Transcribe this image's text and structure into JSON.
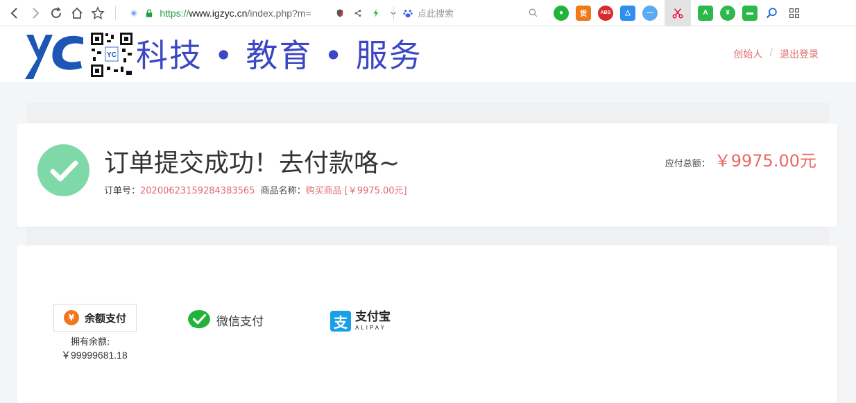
{
  "browser": {
    "url_scheme": "https://",
    "url_host": "www.igzyc.cn",
    "url_path": "/index.php?m=",
    "search_placeholder": "点此搜索"
  },
  "site": {
    "logo_text": "YC",
    "slogan": "科技 • 教育 • 服务",
    "user_link": "创始人",
    "separator": "/",
    "logout_link": "退出登录"
  },
  "order": {
    "title": "订单提交成功！去付款咯~",
    "order_no_label": "订单号：",
    "order_no": "20200623159284383565",
    "product_label": "商品名称：",
    "product_value": "购买商品 [￥9975.00元]",
    "total_label": "应付总额：",
    "total_amount": "￥9975.00元"
  },
  "payment": {
    "balance_label": "余额支付",
    "coin_symbol": "¥",
    "balance_caption": "拥有余额:",
    "balance_value": "￥99999681.18",
    "wechat_label": "微信支付",
    "alipay_icon": "支",
    "alipay_cn": "支付宝",
    "alipay_en": "ALIPAY"
  },
  "colors": {
    "accent_red": "#e06b6b",
    "success_green": "#7ed8a8",
    "slogan_blue": "#3b47c4",
    "wechat_green": "#22b33b",
    "alipay_blue": "#1aa0e8"
  },
  "icons": [
    "back-icon",
    "forward-icon",
    "refresh-icon",
    "home-icon",
    "star-icon",
    "lock-icon",
    "share-icon",
    "lightning-icon",
    "baidu-paw-icon",
    "search-icon",
    "check-icon",
    "wechat-icon",
    "alipay-icon",
    "coin-icon"
  ]
}
